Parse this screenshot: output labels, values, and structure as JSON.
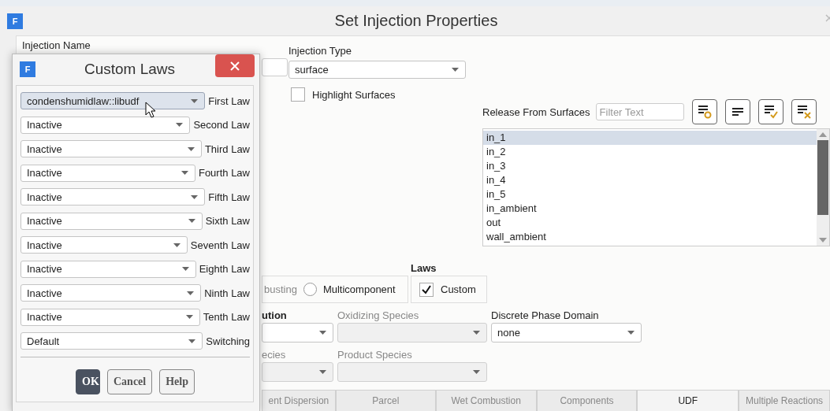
{
  "main_window": {
    "logo": "F",
    "title": "Set Injection Properties"
  },
  "injection_name": {
    "label": "Injection Name"
  },
  "injection_type": {
    "label": "Injection Type",
    "value": "surface"
  },
  "highlight_surfaces": {
    "label": "Highlight Surfaces",
    "checked": false
  },
  "release_from_surfaces": {
    "label": "Release From Surfaces",
    "filter_placeholder": "Filter Text",
    "items": [
      {
        "label": "in_1",
        "selected": true
      },
      {
        "label": "in_2",
        "selected": false
      },
      {
        "label": "in_3",
        "selected": false
      },
      {
        "label": "in_4",
        "selected": false
      },
      {
        "label": "in_5",
        "selected": false
      },
      {
        "label": "in_ambient",
        "selected": false
      },
      {
        "label": "out",
        "selected": false
      },
      {
        "label": "wall_ambient",
        "selected": false
      }
    ]
  },
  "laws": {
    "label": "Laws",
    "particle_options": [
      {
        "kind": "text",
        "label": "busting"
      },
      {
        "kind": "radio",
        "label": "Multicomponent",
        "selected": false
      }
    ],
    "custom": {
      "label": "Custom",
      "checked": true
    }
  },
  "species_fields": [
    {
      "label": "ution",
      "disabled": false
    },
    {
      "label": "Oxidizing Species",
      "disabled": true
    },
    {
      "label": "Discrete Phase Domain",
      "value": "none",
      "disabled": false
    },
    {
      "label": "ecies",
      "disabled": true
    },
    {
      "label": "Product Species",
      "disabled": true
    }
  ],
  "tabs": [
    {
      "label": "ent Dispersion",
      "selected": false
    },
    {
      "label": "Parcel",
      "selected": false
    },
    {
      "label": "Wet Combustion",
      "selected": false
    },
    {
      "label": "Components",
      "selected": false
    },
    {
      "label": "UDF",
      "selected": true
    },
    {
      "label": "Multiple Reactions",
      "selected": false
    }
  ],
  "custom_laws_dialog": {
    "logo": "F",
    "title": "Custom Laws",
    "laws": [
      {
        "value": "condenshumidlaw::libudf",
        "label": "First Law",
        "highlighted": true
      },
      {
        "value": "Inactive",
        "label": "Second Law",
        "highlighted": false
      },
      {
        "value": "Inactive",
        "label": "Third Law",
        "highlighted": false
      },
      {
        "value": "Inactive",
        "label": "Fourth Law",
        "highlighted": false
      },
      {
        "value": "Inactive",
        "label": "Fifth Law",
        "highlighted": false
      },
      {
        "value": "Inactive",
        "label": "Sixth Law",
        "highlighted": false
      },
      {
        "value": "Inactive",
        "label": "Seventh Law",
        "highlighted": false
      },
      {
        "value": "Inactive",
        "label": "Eighth Law",
        "highlighted": false
      },
      {
        "value": "Inactive",
        "label": "Ninth Law",
        "highlighted": false
      },
      {
        "value": "Inactive",
        "label": "Tenth Law",
        "highlighted": false
      },
      {
        "value": "Default",
        "label": "Switching",
        "highlighted": false
      }
    ],
    "buttons": [
      {
        "label": "OK",
        "default": true
      },
      {
        "label": "Cancel",
        "default": false
      },
      {
        "label": "Help",
        "default": false
      }
    ]
  }
}
